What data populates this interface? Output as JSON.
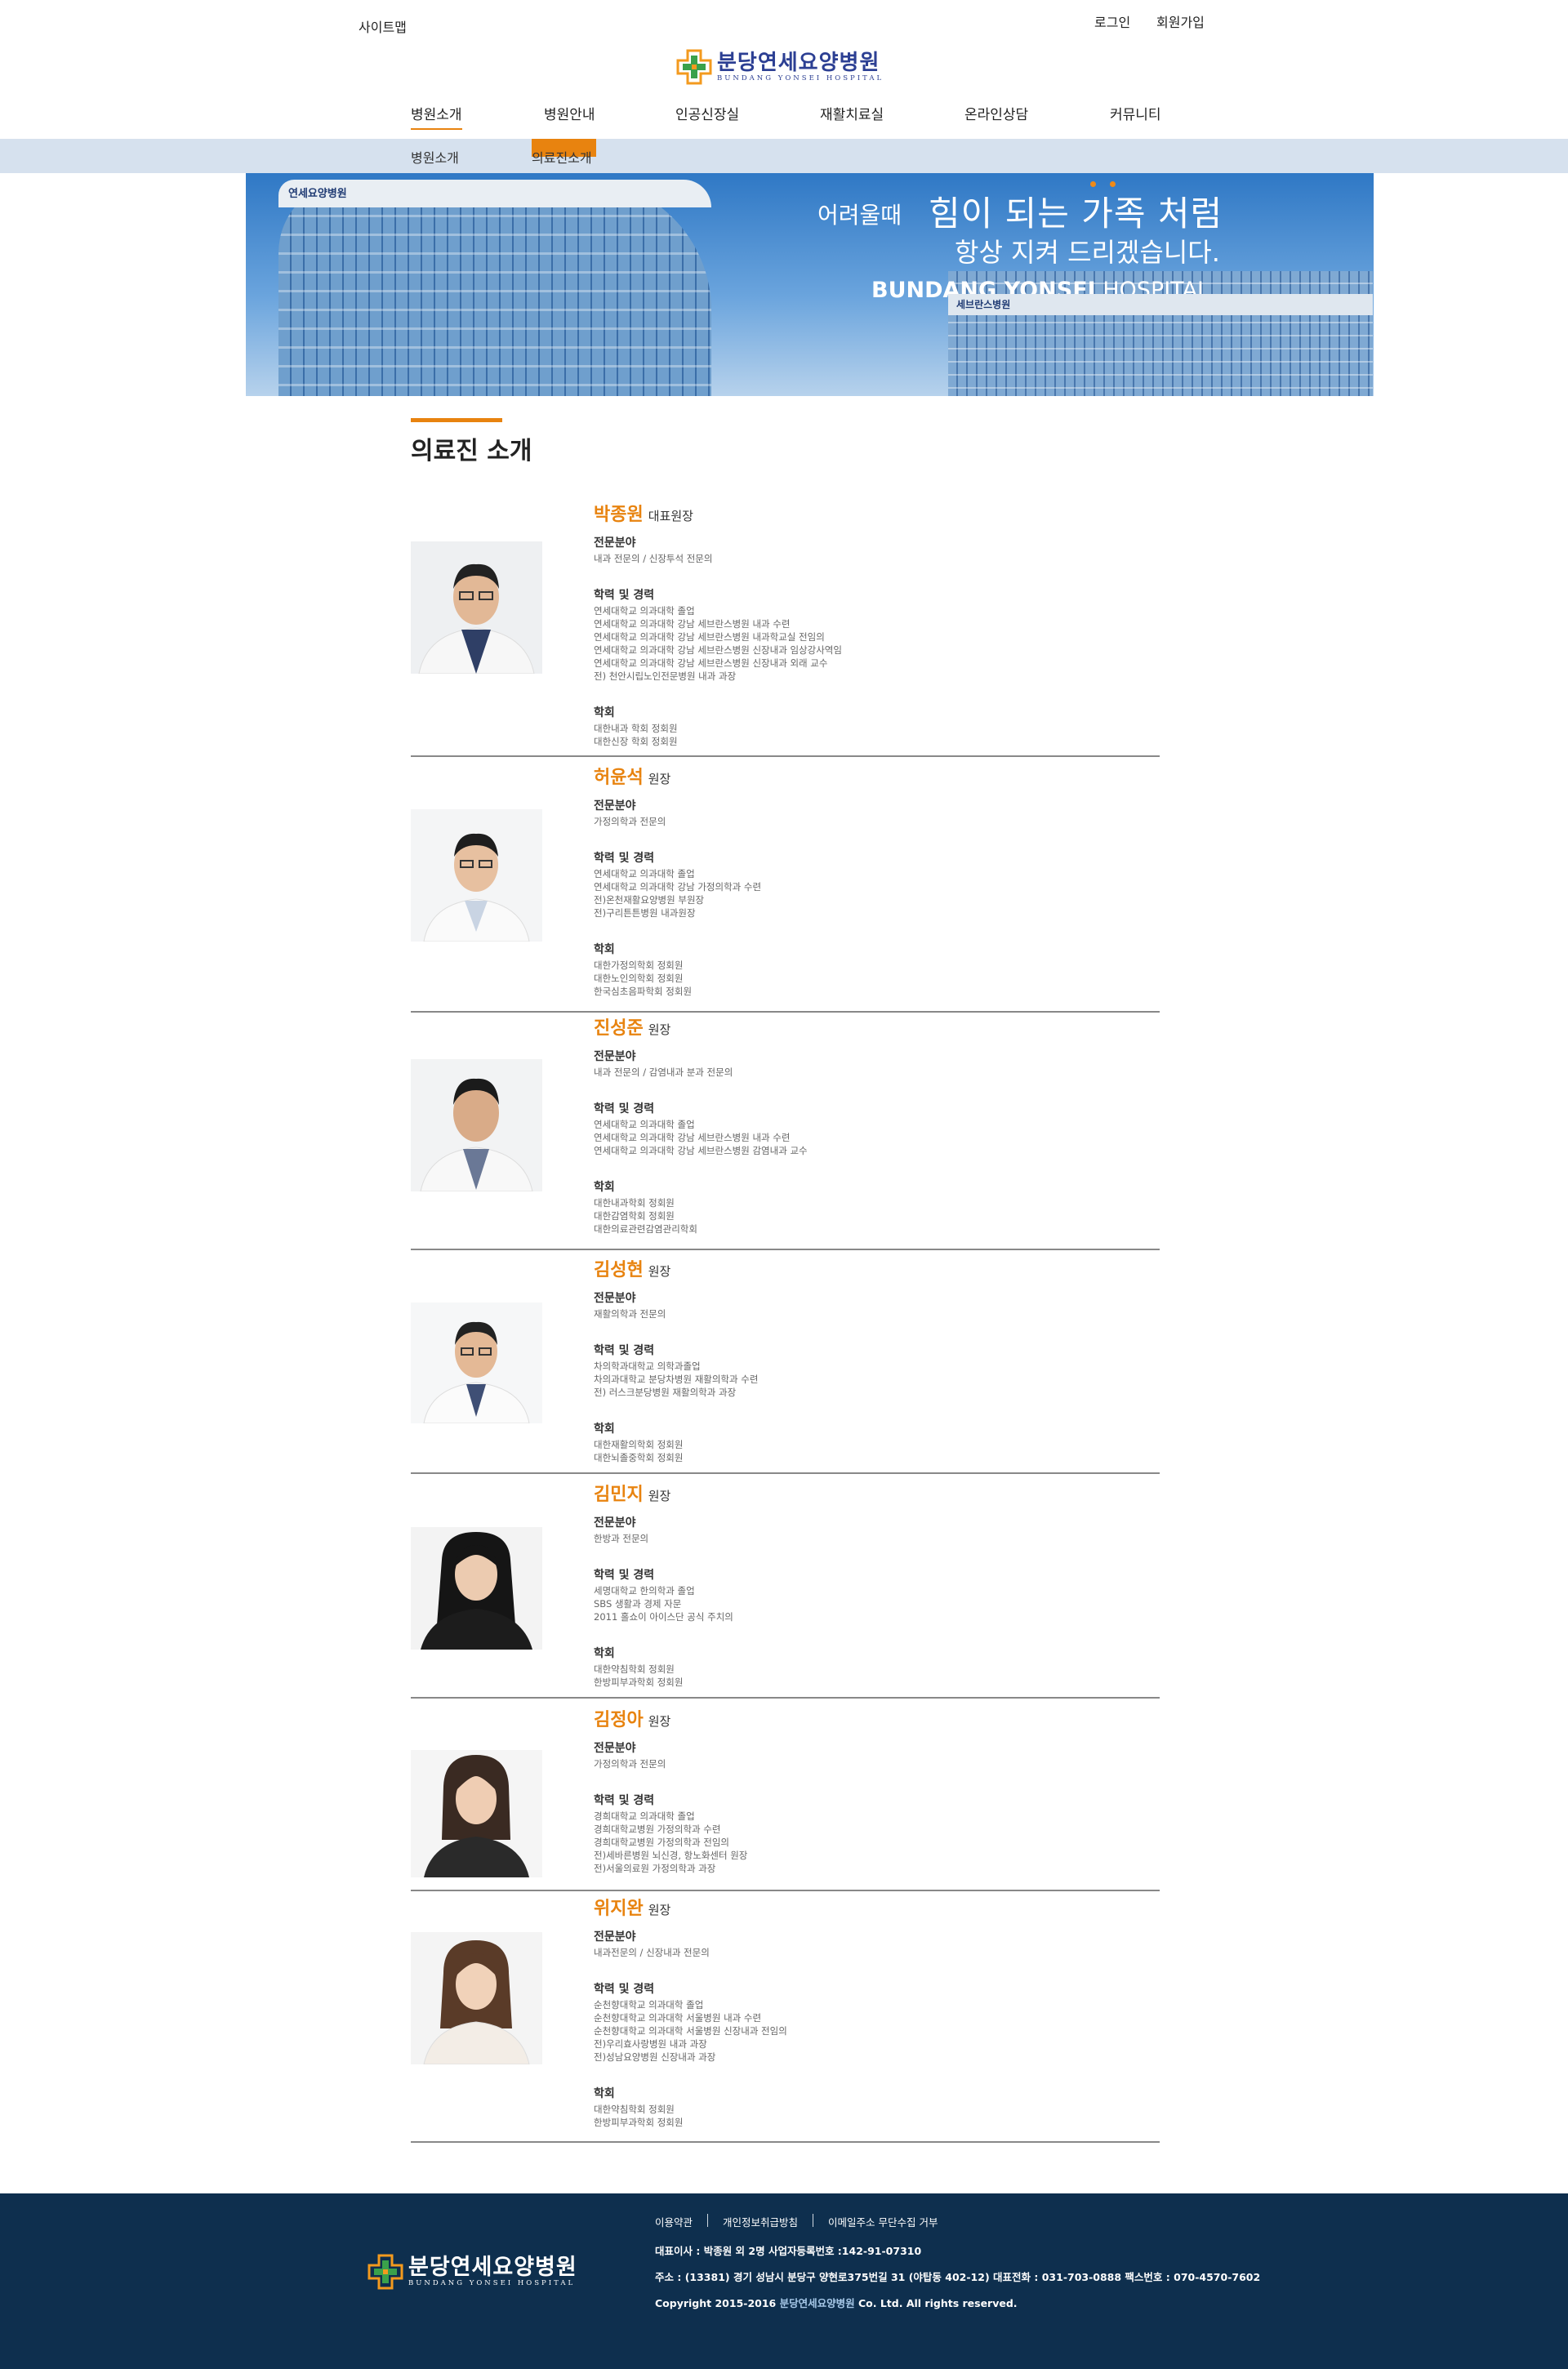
{
  "header": {
    "sitemap": "사이트맵",
    "login": "로그인",
    "signup": "회원가입",
    "logo_kor": "분당연세요양병원",
    "logo_eng": "BUNDANG YONSEI HOSPITAL"
  },
  "gnb": [
    "병원소개",
    "병원안내",
    "인공신장실",
    "재활치료실",
    "온라인상담",
    "커뮤니티"
  ],
  "subnav": [
    "병원소개",
    "의료진소개"
  ],
  "hero": {
    "slogan_small": "어려울때",
    "slogan_big": "힘이 되는 가족 처럼",
    "slogan_line2": "항상 지켜 드리겠습니다.",
    "slogan_en_bold": "BUNDANG YONSEI",
    "slogan_en_light": "HOSPITAL",
    "sign_left": "연세요양병원",
    "sign_right": "세브란스병원"
  },
  "page": {
    "title": "의료진 소개"
  },
  "labels": {
    "field": "전문분야",
    "career": "학력 및 경력",
    "society": "학회"
  },
  "doctors": [
    {
      "name": "박종원",
      "role": "대표원장",
      "field": "내과 전문의 / 신장투석 전문의",
      "career": [
        "연세대학교 의과대학 졸업",
        "연세대학교 의과대학 강남 세브란스병원 내과 수련",
        "연세대학교 의과대학 강남 세브란스병원 내과학교실 전임의",
        "연세대학교 의과대학 강남 세브란스병원 신장내과 임상강사역임",
        "연세대학교 의과대학 강남 세브란스병원 신장내과 외래 교수",
        "전) 천안시립노인전문병원 내과 과장"
      ],
      "society": [
        "대한내과 학회 정회원",
        "대한신장 학회 정회원"
      ]
    },
    {
      "name": "허윤석",
      "role": "원장",
      "field": "가정의학과 전문의",
      "career": [
        "연세대학교 의과대학 졸업",
        "연세대학교 의과대학 강남 가정의학과 수련",
        "전)온천재활요양병원 부원장",
        "전)구리튼튼병원 내과원장"
      ],
      "society": [
        "대한가정의학회 정회원",
        "대한노인의학회 정회원",
        "한국심초음파학회 정회원"
      ]
    },
    {
      "name": "진성준",
      "role": "원장",
      "field": "내과 전문의 / 감염내과 분과 전문의",
      "career": [
        "연세대학교 의과대학 졸업",
        "연세대학교 의과대학 강남 세브란스병원 내과 수련",
        "연세대학교 의과대학 강남 세브란스병원 감염내과 교수"
      ],
      "society": [
        "대한내과학회 정회원",
        "대한감염학회 정회원",
        "대한의료관련감염관리학회"
      ]
    },
    {
      "name": "김성현",
      "role": "원장",
      "field": "재활의학과 전문의",
      "career": [
        "차의학과대학교 의학과졸업",
        "차의과대학교 분당차병원 재활의학과 수련",
        "전) 러스크분당병원 재활의학과 과장"
      ],
      "society": [
        "대한재활의학회 정회원",
        "대한뇌졸중학회 정회원"
      ]
    },
    {
      "name": "김민지",
      "role": "원장",
      "field": "한방과 전문의",
      "career": [
        "세명대학교 한의학과 졸업",
        "SBS 생활과 경제 자문",
        "2011 홀쇼이 아이스단 공식 주치의"
      ],
      "society": [
        "대한약침학회 정회원",
        "한방피부과학회 정회원"
      ]
    },
    {
      "name": "김정아",
      "role": "원장",
      "field": "가정의학과 전문의",
      "career": [
        "경희대학교 의과대학 졸업",
        "경희대학교병원 가정의학과 수련",
        "경희대학교병원 가정의학과 전임의",
        "전)세바른병원 뇌신경, 항노화센터 원장",
        "전)서울의료원 가정의학과 과장"
      ],
      "society": []
    },
    {
      "name": "위지완",
      "role": "원장",
      "field": "내과전문의 / 신장내과 전문의",
      "career": [
        "순천향대학교 의과대학 졸업",
        "순천향대학교 의과대학 서울병원 내과 수련",
        "순천향대학교 의과대학 서울병원 신장내과 전임의",
        "전)우리효사랑병원 내과 과장",
        "전)성남요양병원 신장내과 과장"
      ],
      "society": [
        "대한약침학회 정회원",
        "한방피부과학회 정회원"
      ]
    }
  ],
  "footer": {
    "links": [
      "이용약관",
      "개인정보취급방침",
      "이메일주소 무단수집 거부"
    ],
    "line1": "대표이사 : 박종원 외 2명  사업자등록번호 :142-91-07310",
    "line2": "주소 : (13381) 경기 성남시 분당구 양현로375번길 31 (야탑동 402-12)   대표전화 : 031-703-0888   팩스번호 : 070-4570-7602",
    "copy_prefix": "Copyright 2015-2016",
    "copy_name": "분당연세요양병원",
    "copy_suffix": "Co. Ltd. All rights reserved."
  },
  "colors": {
    "accent": "#e8830f",
    "brand": "#2c3f93",
    "footer_bg": "#0e2f4e",
    "subnav_bg": "#d6e1ee"
  }
}
